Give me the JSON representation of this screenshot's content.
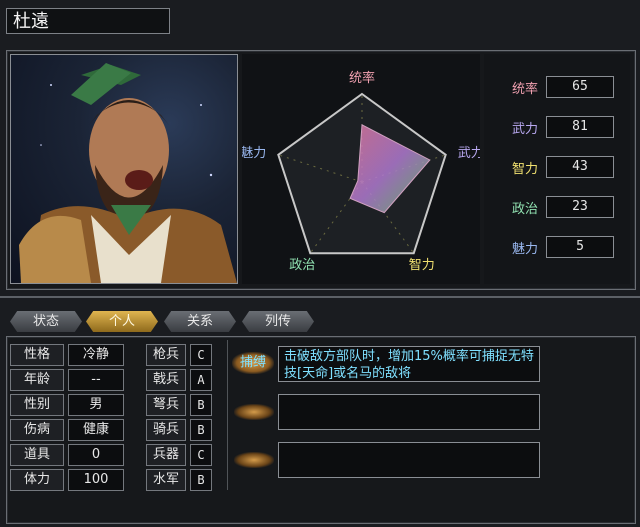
{
  "general": {
    "name": "杜遠"
  },
  "radar": {
    "labels": {
      "top": "统率",
      "right": "武力",
      "bottom_right": "智力",
      "bottom_left": "政治",
      "left": "魅力"
    }
  },
  "stats": [
    {
      "label": "统率",
      "value": "65",
      "color": "#f0a0b0"
    },
    {
      "label": "武力",
      "value": "81",
      "color": "#b8a8f0"
    },
    {
      "label": "智力",
      "value": "43",
      "color": "#f0e070"
    },
    {
      "label": "政治",
      "value": "23",
      "color": "#90e0b0"
    },
    {
      "label": "魅力",
      "value": "5",
      "color": "#9ab8f0"
    }
  ],
  "tabs": [
    {
      "label": "状态"
    },
    {
      "label": "个人"
    },
    {
      "label": "关系"
    },
    {
      "label": "列传"
    }
  ],
  "personal": [
    {
      "key": "性格",
      "value": "冷静"
    },
    {
      "key": "年龄",
      "value": "--"
    },
    {
      "key": "性别",
      "value": "男"
    },
    {
      "key": "伤病",
      "value": "健康"
    },
    {
      "key": "道具",
      "value": "0"
    },
    {
      "key": "体力",
      "value": "100"
    }
  ],
  "units": [
    {
      "key": "枪兵",
      "rank": "C"
    },
    {
      "key": "戟兵",
      "rank": "A"
    },
    {
      "key": "弩兵",
      "rank": "B"
    },
    {
      "key": "骑兵",
      "rank": "B"
    },
    {
      "key": "兵器",
      "rank": "C"
    },
    {
      "key": "水军",
      "rank": "B"
    }
  ],
  "skills": [
    {
      "name": "捕缚",
      "desc": "击破敌方部队时，增加15%概率可捕捉无特技[天命]或名马的敌将"
    },
    {
      "name": "",
      "desc": ""
    },
    {
      "name": "",
      "desc": ""
    }
  ],
  "colors": {
    "accent_tab": "#e0b550",
    "skill_text": "#7fe0ff"
  }
}
